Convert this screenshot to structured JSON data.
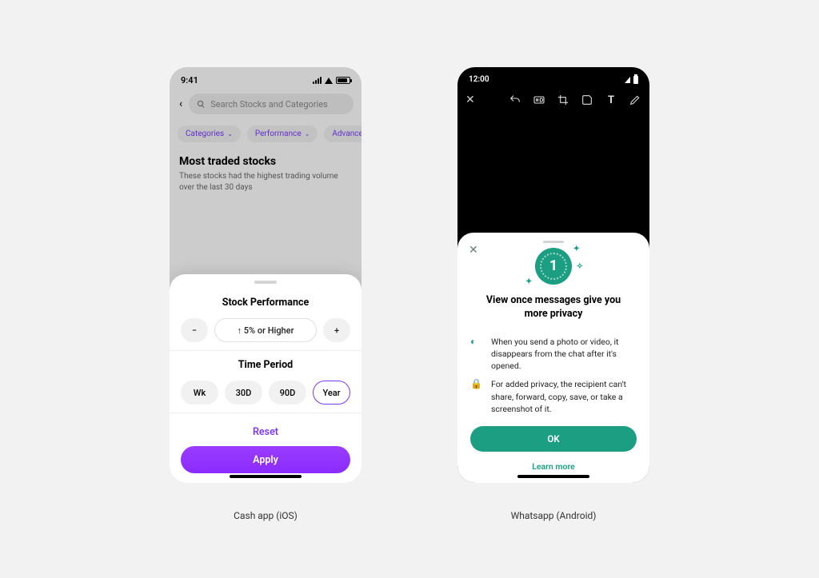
{
  "left": {
    "caption": "Cash app (iOS)",
    "status_time": "9:41",
    "search_placeholder": "Search Stocks and Categories",
    "chips": {
      "categories": "Categories",
      "performance": "Performance",
      "advanced": "Advanced"
    },
    "header": "Most traded stocks",
    "subheader": "These stocks had the highest trading volume over the last 30 days",
    "sheet": {
      "title1": "Stock Performance",
      "chip_current": "↑ 5% or Higher",
      "title2": "Time Period",
      "tp": [
        "Wk",
        "30D",
        "90D",
        "Year"
      ],
      "reset": "Reset",
      "apply": "Apply"
    }
  },
  "right": {
    "caption": "Whatsapp (Android)",
    "status_time": "12:00",
    "sheet": {
      "title": "View once messages give you more privacy",
      "b1": "When you send a photo or video, it disappears from the chat after it's opened.",
      "b2": "For added privacy, the recipient can't share, forward, copy, save, or take a screenshot of it.",
      "ok": "OK",
      "learn": "Learn more"
    }
  }
}
